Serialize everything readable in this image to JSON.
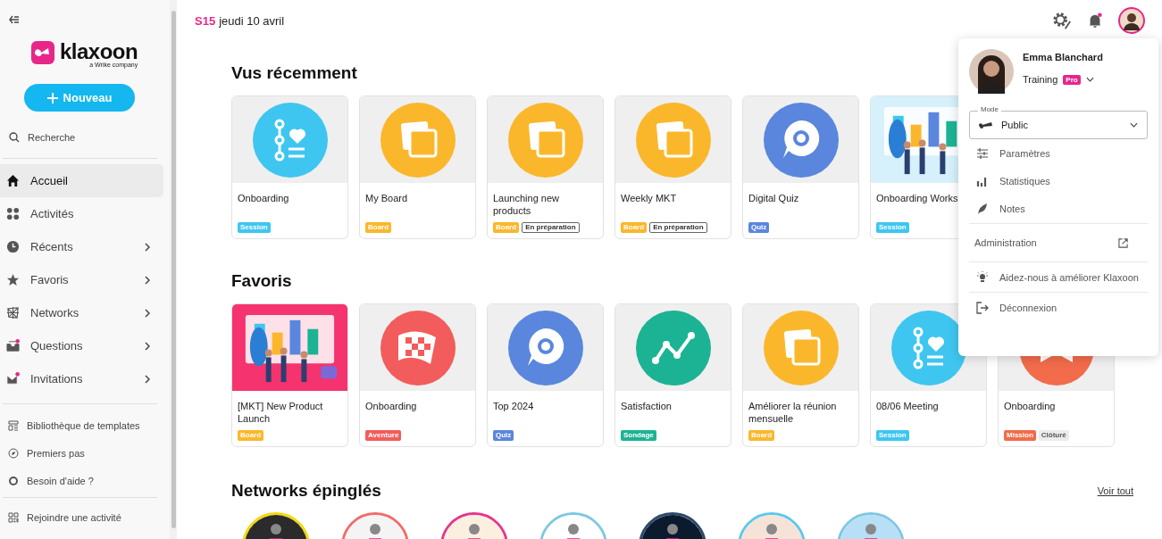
{
  "sidebar": {
    "logo": {
      "name": "klaxoon",
      "tagline": "a Wrike company"
    },
    "new_button": "Nouveau",
    "search": "Recherche",
    "items": [
      {
        "label": "Accueil",
        "selected": true,
        "expandable": false,
        "notification": false
      },
      {
        "label": "Activités",
        "selected": false,
        "expandable": false,
        "notification": false
      },
      {
        "label": "Récents",
        "selected": false,
        "expandable": true,
        "notification": false
      },
      {
        "label": "Favoris",
        "selected": false,
        "expandable": true,
        "notification": false
      },
      {
        "label": "Networks",
        "selected": false,
        "expandable": true,
        "notification": false
      },
      {
        "label": "Questions",
        "selected": false,
        "expandable": true,
        "notification": true
      },
      {
        "label": "Invitations",
        "selected": false,
        "expandable": true,
        "notification": true
      }
    ],
    "links": [
      "Bibliothèque de templates",
      "Premiers pas",
      "Besoin d'aide ?"
    ],
    "join": "Rejoindre une activité"
  },
  "header": {
    "week": "S15",
    "date": "jeudi 10 avril",
    "notification": true
  },
  "sections": [
    {
      "title": "Vus récemment",
      "cards": [
        {
          "title": "Onboarding",
          "thumb": {
            "kind": "session",
            "color": "#3ec6f0"
          },
          "tags": [
            {
              "label": "Session",
              "kind": "type",
              "color": "#3ec6f0"
            }
          ]
        },
        {
          "title": "My Board",
          "thumb": {
            "kind": "board",
            "color": "#fbb72c"
          },
          "tags": [
            {
              "label": "Board",
              "kind": "type",
              "color": "#fbb72c"
            }
          ]
        },
        {
          "title": "Launching new products",
          "thumb": {
            "kind": "board",
            "color": "#fbb72c"
          },
          "tags": [
            {
              "label": "Board",
              "kind": "type",
              "color": "#fbb72c"
            },
            {
              "label": "En préparation",
              "kind": "outline"
            }
          ]
        },
        {
          "title": "Weekly MKT",
          "thumb": {
            "kind": "board",
            "color": "#fbb72c"
          },
          "tags": [
            {
              "label": "Board",
              "kind": "type",
              "color": "#fbb72c"
            },
            {
              "label": "En préparation",
              "kind": "outline"
            }
          ]
        },
        {
          "title": "Digital Quiz",
          "thumb": {
            "kind": "quiz",
            "color": "#5a86dd"
          },
          "tags": [
            {
              "label": "Quiz",
              "kind": "type",
              "color": "#5a86dd"
            }
          ]
        },
        {
          "title": "Onboarding Works",
          "thumb": {
            "kind": "picture",
            "color": "#d6f1fb"
          },
          "tags": [
            {
              "label": "Session",
              "kind": "type",
              "color": "#3ec6f0"
            }
          ]
        }
      ]
    },
    {
      "title": "Favoris",
      "cards": [
        {
          "title": "[MKT] New Product Launch",
          "thumb": {
            "kind": "picture",
            "color": "#f5336e"
          },
          "tags": [
            {
              "label": "Board",
              "kind": "type",
              "color": "#fbb72c"
            }
          ]
        },
        {
          "title": "Onboarding",
          "thumb": {
            "kind": "aventure",
            "color": "#f25c5c"
          },
          "tags": [
            {
              "label": "Aventure",
              "kind": "type",
              "color": "#f25c5c"
            }
          ]
        },
        {
          "title": "Top 2024",
          "thumb": {
            "kind": "quiz",
            "color": "#5a86dd"
          },
          "tags": [
            {
              "label": "Quiz",
              "kind": "type",
              "color": "#5a86dd"
            }
          ]
        },
        {
          "title": "Satisfaction",
          "thumb": {
            "kind": "sondage",
            "color": "#1cb394"
          },
          "tags": [
            {
              "label": "Sondage",
              "kind": "type",
              "color": "#1cb394"
            }
          ]
        },
        {
          "title": "Améliorer la réunion mensuelle",
          "thumb": {
            "kind": "board",
            "color": "#fbb72c"
          },
          "tags": [
            {
              "label": "Board",
              "kind": "type",
              "color": "#fbb72c"
            }
          ]
        },
        {
          "title": "08/06 Meeting",
          "thumb": {
            "kind": "session",
            "color": "#3ec6f0"
          },
          "tags": [
            {
              "label": "Session",
              "kind": "type",
              "color": "#3ec6f0"
            }
          ]
        },
        {
          "title": "Onboarding",
          "thumb": {
            "kind": "mission",
            "color": "#f26b4b"
          },
          "tags": [
            {
              "label": "Mission",
              "kind": "type",
              "color": "#f26b4b"
            },
            {
              "label": "Clôturé",
              "kind": "muted"
            }
          ]
        }
      ]
    }
  ],
  "networks": {
    "title": "Networks épinglés",
    "see_all": "Voir tout",
    "items": [
      {
        "color": "#f5d90a"
      },
      {
        "color": "#f26b6b"
      },
      {
        "color": "#e8358c"
      },
      {
        "color": "#7ec8e3"
      },
      {
        "color": "#2d4a6b"
      },
      {
        "color": "#5cc8f0"
      },
      {
        "color": "#7ec8e3"
      }
    ]
  },
  "account_menu": {
    "name": "Emma Blanchard",
    "workspace": "Training",
    "plan_badge": "Pro",
    "mode": {
      "label": "Mode",
      "value": "Public"
    },
    "sections": [
      [
        {
          "label": "Paramètres",
          "external": false
        },
        {
          "label": "Statistiques",
          "external": false
        },
        {
          "label": "Notes",
          "external": false
        }
      ],
      [
        {
          "label": "Administration",
          "external": true
        }
      ],
      [
        {
          "label": "Aidez-nous à améliorer Klaxoon",
          "external": false
        }
      ],
      [
        {
          "label": "Déconnexion",
          "external": false
        }
      ]
    ]
  }
}
